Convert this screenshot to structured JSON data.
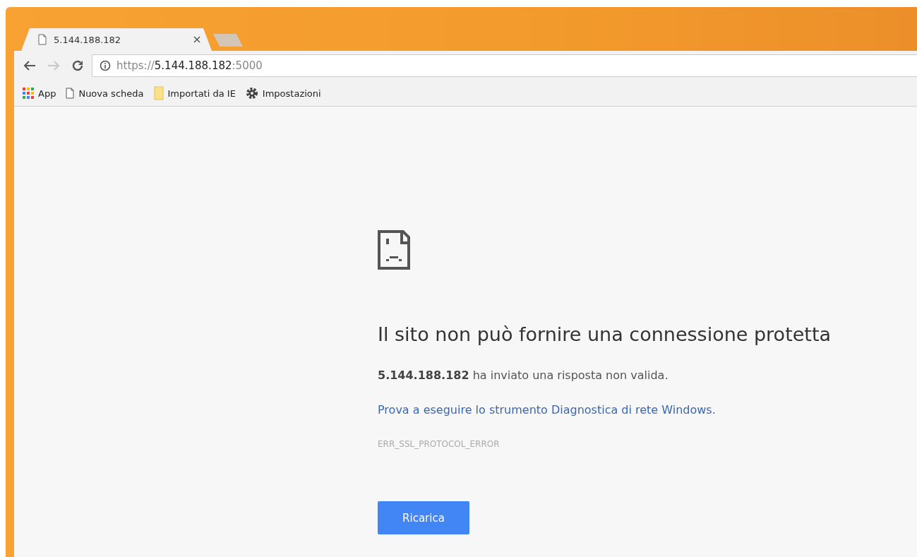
{
  "tabs": [
    {
      "title": "5.144.188.182",
      "selected": true
    }
  ],
  "toolbar": {
    "back_disabled": false,
    "forward_disabled": true,
    "url_scheme": "https://",
    "url_host": "5.144.188.182",
    "url_port": ":5000"
  },
  "bookmarks": [
    {
      "kind": "apps",
      "label": "App"
    },
    {
      "kind": "page",
      "label": "Nuova scheda"
    },
    {
      "kind": "folder",
      "label": "Importati da IE"
    },
    {
      "kind": "gear",
      "label": "Impostazioni"
    }
  ],
  "error": {
    "heading": "Il sito non può fornire una connessione protetta",
    "message": "**5.144.188.182** ha inviato una risposta non valida.",
    "link": "Prova a eseguire lo strumento Diagnostica di rete Windows.",
    "code": "ERR_SSL_PROTOCOL_ERROR",
    "button": "Ricarica"
  }
}
